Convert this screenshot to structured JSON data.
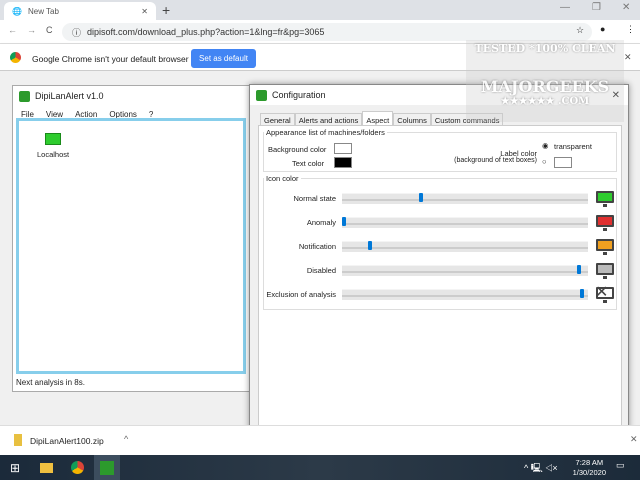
{
  "browser": {
    "tab_title": "New Tab",
    "url": "dipisoft.com/download_plus.php?action=1&lng=fr&pg=3065",
    "infobar_text": "Google Chrome isn't your default browser",
    "set_default_label": "Set as default"
  },
  "watermark": {
    "line1": "TESTED *100% CLEAN",
    "line2": "MAJORGEEKS",
    "line3": ".COM"
  },
  "dipi": {
    "title": "DipiLanAlert v1.0",
    "menu": [
      "File",
      "View",
      "Action",
      "Options",
      "?"
    ],
    "machine": "Localhost",
    "status": "Next analysis in 8s."
  },
  "config": {
    "title": "Configuration",
    "tabs": [
      "General",
      "Alerts and actions",
      "Aspect",
      "Columns",
      "Custom commands"
    ],
    "active_tab": "Aspect",
    "appearance_legend": "Appearance list of machines/folders",
    "bg_color_label": "Background color",
    "text_color_label": "Text color",
    "label_color_label": "Label color",
    "label_color_sub": "(background of text boxes)",
    "transparent_label": "transparent",
    "icon_color_legend": "Icon color",
    "sliders": [
      {
        "label": "Normal state",
        "value": 0.32,
        "color": "#2ecc2e"
      },
      {
        "label": "Anomaly",
        "value": 0.0,
        "color": "#e03030"
      },
      {
        "label": "Notification",
        "value": 0.11,
        "color": "#f0a020"
      },
      {
        "label": "Disabled",
        "value": 0.98,
        "color": "#bbbbbb"
      },
      {
        "label": "Exclusion of analysis",
        "value": 0.99,
        "color": "#ffffff"
      }
    ]
  },
  "download": {
    "file": "DipiLanAlert100.zip"
  },
  "taskbar": {
    "time": "7:28 AM",
    "date": "1/30/2020"
  }
}
